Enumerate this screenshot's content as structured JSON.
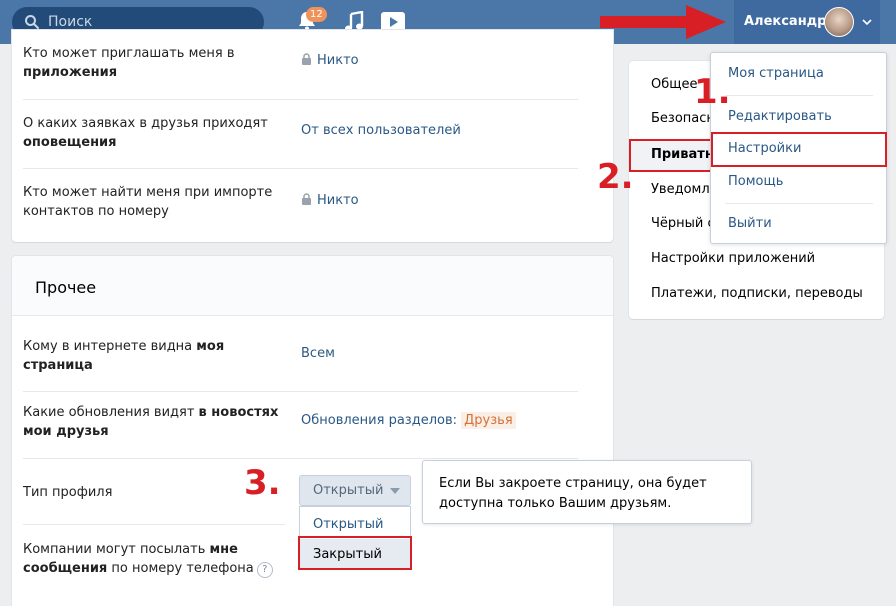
{
  "header": {
    "search_placeholder": "Поиск",
    "notifications_count": "12",
    "user_name": "Александр"
  },
  "privacy_top": {
    "rows": [
      {
        "label_pre": "Кто может приглашать меня в ",
        "label_bold": "приложения",
        "label_post": "",
        "value": "Никто"
      },
      {
        "label_pre": "О каких заявках в друзья приходят ",
        "label_bold": "оповещения",
        "label_post": "",
        "value": "От всех пользователей"
      },
      {
        "label_pre": "Кто может найти меня при импорте контактов по номеру",
        "label_bold": "",
        "label_post": "",
        "value": "Никто"
      }
    ]
  },
  "other": {
    "title": "Прочее",
    "row1": {
      "label_pre": "Кому в интернете видна ",
      "label_bold": "моя страница",
      "value": "Всем"
    },
    "row2": {
      "label_pre": "Какие обновления видят ",
      "label_bold": "в новостях мои друзья",
      "value": "Обновления разделов:",
      "tag": "Друзья"
    },
    "row3": {
      "label": "Тип профиля"
    },
    "row4": {
      "label_pre": "Компании могут посылать ",
      "label_bold": "мне сообщения",
      "label_post": " по номеру телефона",
      "help": "?"
    },
    "profile_dropdown": {
      "selected": "Открытый",
      "options": [
        "Открытый",
        "Закрытый"
      ]
    },
    "tooltip": "Если Вы закроете страницу, она будет доступна только Вашим друзьям."
  },
  "settings_nav": {
    "items": [
      "Общее",
      "Безопасность",
      "Приватность",
      "Уведомления",
      "Чёрный список",
      "Настройки приложений",
      "Платежи, подписки, переводы"
    ]
  },
  "user_menu": {
    "items": [
      "Моя страница",
      "Редактировать",
      "Настройки",
      "Помощь",
      "Выйти"
    ]
  },
  "annotations": {
    "step1": "1.",
    "step2": "2.",
    "step3": "3."
  },
  "colors": {
    "header_bg": "#4a76a8",
    "link": "#2a5885",
    "annotation_red": "#d81f26"
  }
}
